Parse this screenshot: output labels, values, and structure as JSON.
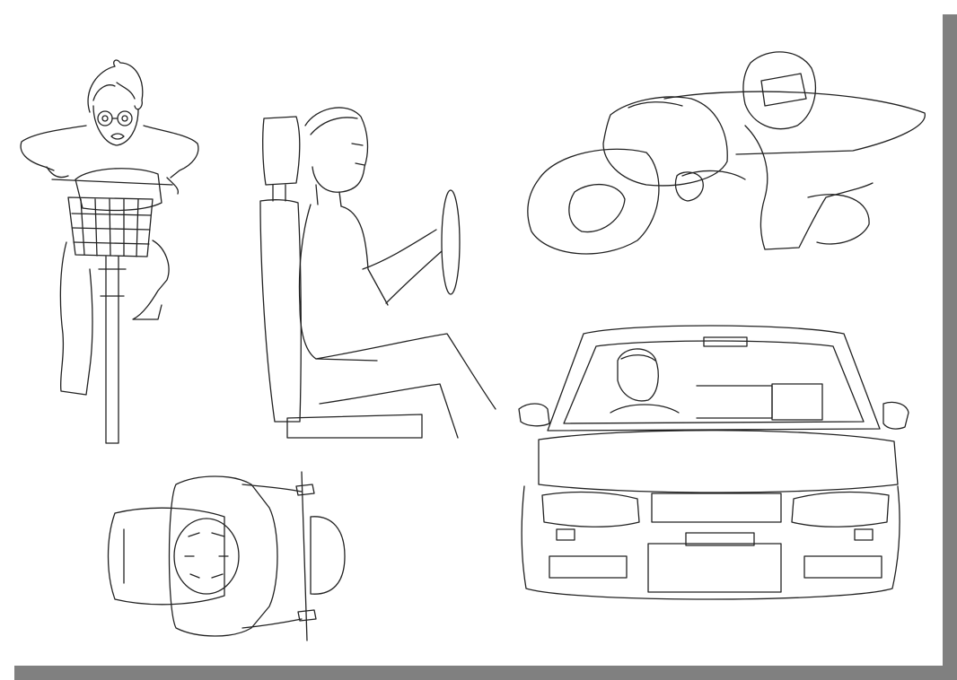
{
  "colors": {
    "paper": "#ffffff",
    "ink": "#222222",
    "shadow": "#808080"
  },
  "figures": [
    {
      "name": "boy-on-bicycle-front-view"
    },
    {
      "name": "man-driving-side-view"
    },
    {
      "name": "rider-on-motorcycle-leaning"
    },
    {
      "name": "rider-on-scooter-top-view"
    },
    {
      "name": "driver-in-car-front-view"
    }
  ]
}
